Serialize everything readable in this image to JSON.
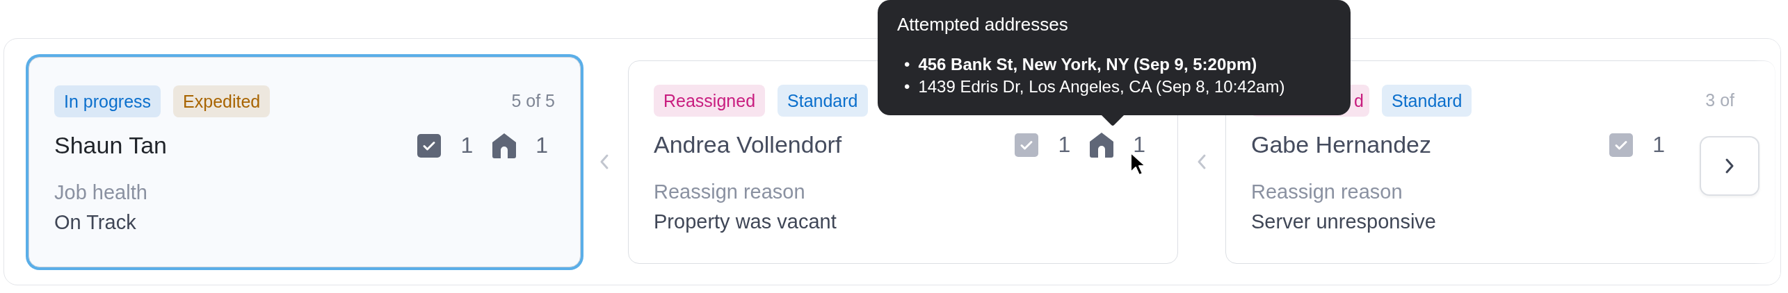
{
  "cards": [
    {
      "selected": true,
      "tags": [
        {
          "label": "In progress",
          "color": "#0b6fcc"
        },
        {
          "label": "Expedited",
          "color": "#a86400"
        }
      ],
      "position": "5 of 5",
      "name": "Shaun Tan",
      "stats": [
        {
          "kind": "tasks",
          "count": "1",
          "highlighted": true
        },
        {
          "kind": "addresses",
          "count": "1",
          "highlighted": true
        }
      ],
      "field_label": "Job health",
      "field_value": "On Track"
    },
    {
      "selected": false,
      "tags": [
        {
          "label": "Reassigned",
          "color": "#c81d7f"
        },
        {
          "label": "Standard",
          "color": "#0b6fcc"
        }
      ],
      "name": "Andrea Vollendorf",
      "stats": [
        {
          "kind": "tasks",
          "count": "1",
          "highlighted": false
        },
        {
          "kind": "addresses",
          "count": "1",
          "highlighted": true
        }
      ],
      "field_label": "Reassign reason",
      "field_value": "Property was vacant"
    },
    {
      "selected": false,
      "tags": [
        {
          "label": "d",
          "color": "#c81d7f"
        },
        {
          "label": "Standard",
          "color": "#0b6fcc"
        }
      ],
      "position": "3 of",
      "name": "Gabe Hernandez",
      "stats": [
        {
          "kind": "tasks",
          "count": "1",
          "highlighted": false
        }
      ],
      "field_label": "Reassign reason",
      "field_value": "Server unresponsive"
    }
  ],
  "tooltip": {
    "title": "Attempted addresses",
    "items": [
      {
        "marker": "•",
        "text": "456 Bank St, New York, NY (Sep 9, 5:20pm)",
        "bold": true
      },
      {
        "marker": "•",
        "text": "1439 Edris Dr, Los Angeles, CA (Sep 8, 10:42am)",
        "bold": false
      }
    ]
  }
}
